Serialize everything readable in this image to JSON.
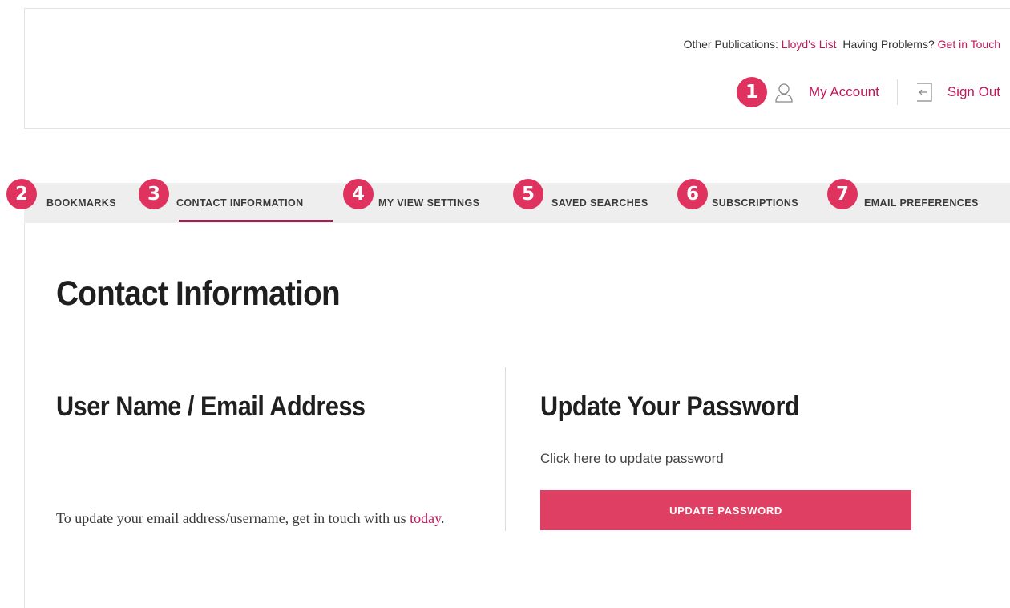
{
  "header": {
    "other_publications_label": "Other Publications:",
    "other_publications_link": "Lloyd's List",
    "problems_label": "Having Problems?",
    "get_in_touch_link": "Get in Touch",
    "my_account": "My Account",
    "sign_out": "Sign Out",
    "account_badge": "1",
    "icons": {
      "account": "user-icon",
      "sign_out": "sign-out-icon"
    }
  },
  "tabs": [
    {
      "badge": "2",
      "label": "BOOKMARKS"
    },
    {
      "badge": "3",
      "label": "CONTACT INFORMATION",
      "active": true
    },
    {
      "badge": "4",
      "label": "MY VIEW SETTINGS"
    },
    {
      "badge": "5",
      "label": "SAVED SEARCHES"
    },
    {
      "badge": "6",
      "label": "SUBSCRIPTIONS"
    },
    {
      "badge": "7",
      "label": "EMAIL PREFERENCES"
    }
  ],
  "page": {
    "title": "Contact Information",
    "username_section": {
      "title": "User Name / Email Address",
      "help_text": "To update your email address/username, get in touch with us ",
      "help_link": "today",
      "help_suffix": "."
    },
    "password_section": {
      "title": "Update Your Password",
      "description": "Click here to update password",
      "button_label": "UPDATE PASSWORD"
    }
  },
  "colors": {
    "accent": "#c2185b",
    "badge": "#e0325f",
    "button": "#e03f64",
    "tab_active_underline": "#9c2350",
    "tab_bar": "#eeeeee"
  }
}
